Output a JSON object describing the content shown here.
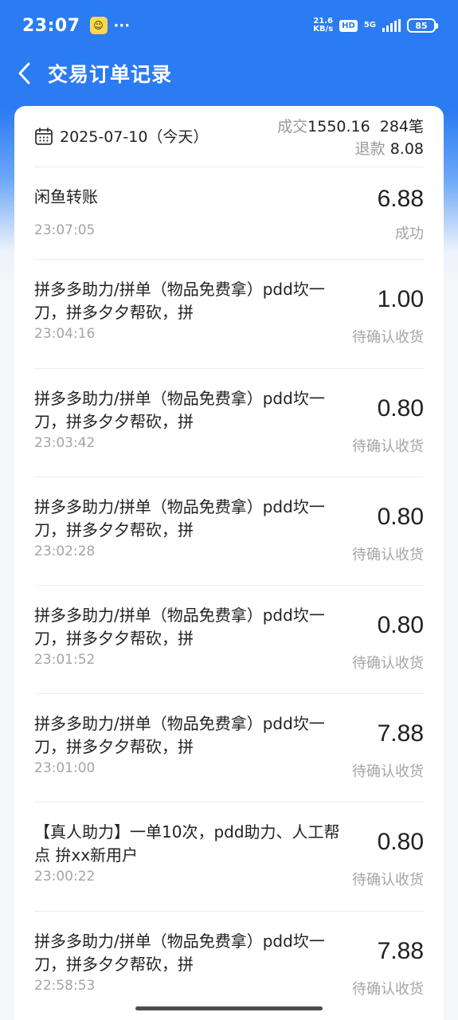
{
  "status_bar": {
    "time": "23:07",
    "dots": "···",
    "net_speed_value": "21.6",
    "net_speed_unit": "KB/s",
    "hd": "HD",
    "net_type": "5G",
    "battery": "85"
  },
  "header": {
    "title": "交易订单记录"
  },
  "summary": {
    "date": "2025-07-10（今天）",
    "deal_label": "成交",
    "deal_amount": "1550.16",
    "deal_count": "284笔",
    "refund_label": "退款",
    "refund_amount": "8.08"
  },
  "orders": [
    {
      "title": "闲鱼转账",
      "time": "23:07:05",
      "amount": "6.88",
      "status": "成功"
    },
    {
      "title": "拼多多助力/拼单（物品免费拿）pdd坎一刀，拼多夕夕帮砍，拼",
      "time": "23:04:16",
      "amount": "1.00",
      "status": "待确认收货"
    },
    {
      "title": "拼多多助力/拼单（物品免费拿）pdd坎一刀，拼多夕夕帮砍，拼",
      "time": "23:03:42",
      "amount": "0.80",
      "status": "待确认收货"
    },
    {
      "title": "拼多多助力/拼单（物品免费拿）pdd坎一刀，拼多夕夕帮砍，拼",
      "time": "23:02:28",
      "amount": "0.80",
      "status": "待确认收货"
    },
    {
      "title": "拼多多助力/拼单（物品免费拿）pdd坎一刀，拼多夕夕帮砍，拼",
      "time": "23:01:52",
      "amount": "0.80",
      "status": "待确认收货"
    },
    {
      "title": "拼多多助力/拼单（物品免费拿）pdd坎一刀，拼多夕夕帮砍，拼",
      "time": "23:01:00",
      "amount": "7.88",
      "status": "待确认收货"
    },
    {
      "title": "【真人助力】一单10次，pdd助力、人工帮点 拚xx新用户",
      "time": "23:00:22",
      "amount": "0.80",
      "status": "待确认收货"
    },
    {
      "title": "拼多多助力/拼单（物品免费拿）pdd坎一刀，拼多夕夕帮砍，拼",
      "time": "22:58:53",
      "amount": "7.88",
      "status": "待确认收货"
    }
  ]
}
